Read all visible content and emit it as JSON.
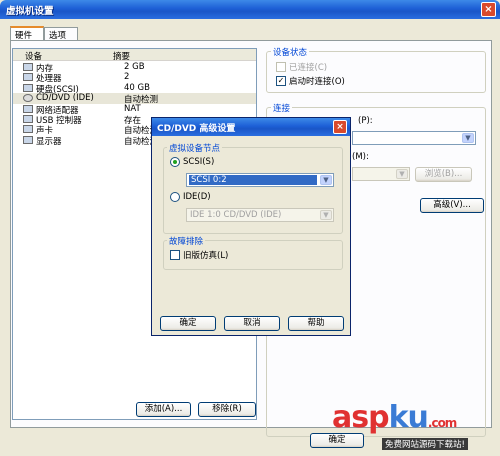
{
  "window": {
    "title": "虚拟机设置",
    "close_glyph": "×"
  },
  "tabs": [
    {
      "label": "硬件"
    },
    {
      "label": "选项"
    }
  ],
  "device_list": {
    "col_device": "设备",
    "col_summary": "摘要",
    "rows": [
      {
        "name": "内存",
        "summary": "2 GB",
        "icon": "memory-icon"
      },
      {
        "name": "处理器",
        "summary": "2",
        "icon": "cpu-icon"
      },
      {
        "name": "硬盘(SCSI)",
        "summary": "40 GB",
        "icon": "harddisk-icon"
      },
      {
        "name": "CD/DVD (IDE)",
        "summary": "自动检测",
        "icon": "cdrom-icon",
        "selected": true
      },
      {
        "name": "网络适配器",
        "summary": "NAT",
        "icon": "network-icon"
      },
      {
        "name": "USB 控制器",
        "summary": "存在",
        "icon": "usb-icon"
      },
      {
        "name": "声卡",
        "summary": "自动检测",
        "icon": "sound-icon"
      },
      {
        "name": "显示器",
        "summary": "自动检测",
        "icon": "display-icon"
      }
    ],
    "add_button": "添加(A)...",
    "remove_button": "移除(R)"
  },
  "device_status": {
    "title": "设备状态",
    "connected_label": "已连接(C)",
    "connected_checked": false,
    "connect_on_poweron_label": "启动时连接(O)",
    "connect_on_poweron_checked": true
  },
  "connection": {
    "title": "连接",
    "partial_label_1": "(P):",
    "partial_label_2": "(M):",
    "browse_button": "浏览(B)...",
    "advanced_button": "高级(V)..."
  },
  "bottom_buttons": {
    "ok": "确定"
  },
  "dialog": {
    "title": "CD/DVD 高级设置",
    "close_glyph": "×",
    "node_group_title": "虚拟设备节点",
    "scsi_label": "SCSI(S)",
    "scsi_selected": true,
    "scsi_value": "SCSI 0:2",
    "ide_label": "IDE(D)",
    "ide_value": "IDE 1:0   CD/DVD (IDE)",
    "troubleshoot_title": "故障排除",
    "legacy_label": "旧版仿真(L)",
    "legacy_checked": false,
    "ok_button": "确定",
    "cancel_button": "取消",
    "help_button": "帮助"
  },
  "watermark": {
    "main_a": "asp",
    "main_b": "ku",
    "main_c": ".com",
    "sub": "免费网站源码下载站!"
  },
  "colors": {
    "titlebar": "#1d5fd6",
    "selection": "#e8e6d8",
    "radio_dot": "#21a121",
    "watermark_red": "#e03131",
    "watermark_blue": "#3a7bd5"
  }
}
